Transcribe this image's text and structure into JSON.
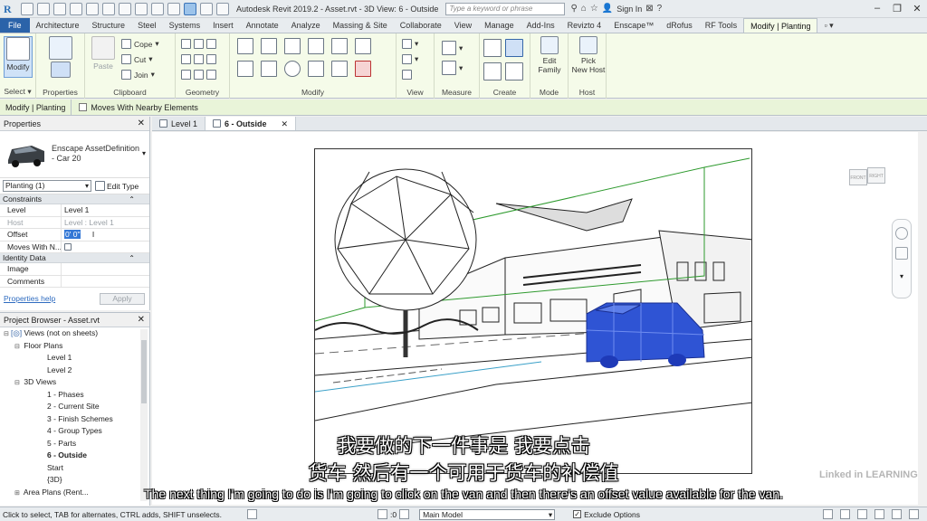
{
  "titlebar": {
    "app_title": "Autodesk Revit 2019.2 - Asset.rvt - 3D View: 6 - Outside",
    "search_placeholder": "Type a keyword or phrase",
    "sign_in": "Sign In"
  },
  "ribbon_tabs": [
    "File",
    "Architecture",
    "Structure",
    "Steel",
    "Systems",
    "Insert",
    "Annotate",
    "Analyze",
    "Massing & Site",
    "Collaborate",
    "View",
    "Manage",
    "Add-Ins",
    "Revizto 4",
    "Enscape™",
    "dRofus",
    "RF Tools",
    "Modify | Planting"
  ],
  "ribbon": {
    "modify": "Modify",
    "select": "Select",
    "properties": "Properties",
    "paste": "Paste",
    "cope": "Cope",
    "cut": "Cut",
    "join": "Join",
    "clipboard": "Clipboard",
    "geometry": "Geometry",
    "modify_panel": "Modify",
    "view": "View",
    "measure": "Measure",
    "create": "Create",
    "edit_family_1": "Edit",
    "edit_family_2": "Family",
    "mode": "Mode",
    "pick_host_1": "Pick",
    "pick_host_2": "New Host",
    "host": "Host"
  },
  "options_bar": {
    "context": "Modify | Planting",
    "moves_with_nearby": "Moves With Nearby Elements"
  },
  "properties": {
    "title": "Properties",
    "type_name_1": "Enscape AssetDefinition",
    "type_name_2": "- Car 20",
    "instance_filter": "Planting (1)",
    "edit_type": "Edit Type",
    "groups": {
      "constraints": "Constraints",
      "identity": "Identity Data"
    },
    "rows": {
      "level_k": "Level",
      "level_v": "Level 1",
      "host_k": "Host",
      "host_v": "Level : Level 1",
      "offset_k": "Offset",
      "offset_v": "0'  0\"",
      "moves_k": "Moves With N...",
      "image_k": "Image",
      "comments_k": "Comments"
    },
    "help": "Properties help",
    "apply": "Apply"
  },
  "browser": {
    "title": "Project Browser - Asset.rvt",
    "nodes": {
      "views_root": "Views (not on sheets)",
      "floor_plans": "Floor Plans",
      "level1": "Level 1",
      "level2": "Level 2",
      "views3d": "3D Views",
      "v1": "1 - Phases",
      "v2": "2 - Current Site",
      "v3": "3 - Finish Schemes",
      "v4": "4 - Group Types",
      "v5": "5 - Parts",
      "v6": "6 - Outside",
      "start": "Start",
      "v3d": "{3D}",
      "area_plans": "Area Plans (Rent..."
    }
  },
  "view_tabs": {
    "tab1": "Level 1",
    "tab2": "6 - Outside"
  },
  "viewcube": {
    "front": "FRONT",
    "right": "RIGHT"
  },
  "subtitles": {
    "zh_line1": "我要做的下一件事是 我要点击",
    "zh_line2": "货车 然后有一个可用于货车的补偿值",
    "en": "The next thing I'm going to do is I'm going to click on the van and then there's an offset value available for the van."
  },
  "watermark": "Linked in LEARNING",
  "statusbar": {
    "text": "Click to select, TAB for alternates, CTRL adds, SHIFT unselects.",
    "zoom": ":0",
    "model": "Main Model",
    "exclude_options": "Exclude Options"
  },
  "colors": {
    "file_tab": "#2b63a9",
    "contextual_ribbon": "#f5fbe9",
    "selection": "#3478d6",
    "van_selected": "#2f54d4",
    "bbox_green": "#2e9a2e"
  }
}
